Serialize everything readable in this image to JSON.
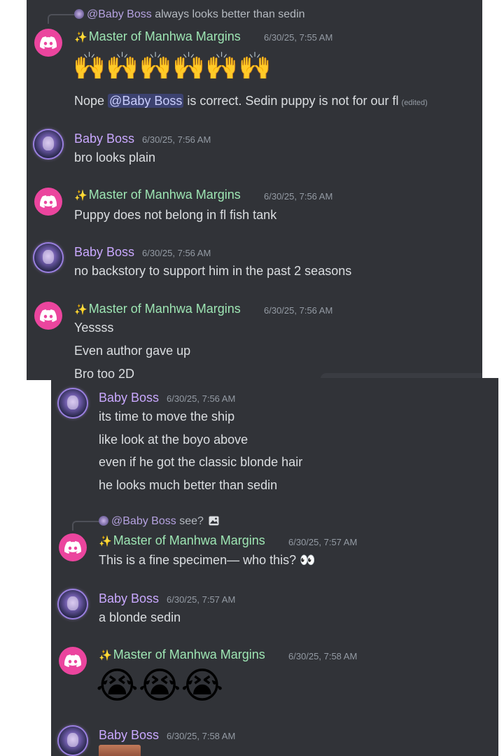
{
  "users": {
    "master": "Master of Manhwa Margins",
    "boss": "Baby Boss"
  },
  "top": {
    "m1": {
      "reply_name": "@Baby Boss",
      "reply_text": "always looks better than sedin",
      "time": "6/30/25, 7:55 AM",
      "emoji": "🙌🙌🙌🙌🙌🙌",
      "text_before": "Nope ",
      "mention": "@Baby Boss",
      "text_after": " is correct. Sedin puppy is not for our fl",
      "edited": "(edited)"
    },
    "m2": {
      "time": "6/30/25, 7:56 AM",
      "lines": [
        "bro looks plain"
      ]
    },
    "m3": {
      "time": "6/30/25, 7:56 AM",
      "lines": [
        "Puppy does not belong in fl fish tank"
      ]
    },
    "m4": {
      "time": "6/30/25, 7:56 AM",
      "lines": [
        "no backstory to support him in the past 2 seasons"
      ]
    },
    "m5": {
      "time": "6/30/25, 7:56 AM",
      "lines": [
        "Yessss",
        "Even author gave up",
        "Bro too 2D"
      ]
    }
  },
  "bottom": {
    "m1": {
      "time": "6/30/25, 7:56 AM",
      "lines": [
        "its time to move the ship",
        "like look at the boyo above",
        "even if he got the classic blonde hair",
        "he looks much better than sedin"
      ]
    },
    "m2": {
      "reply_name": "@Baby Boss",
      "reply_text": "see?",
      "time": "6/30/25, 7:57 AM",
      "text": "This is a fine specimen— who this? 👀"
    },
    "m3": {
      "time": "6/30/25, 7:57 AM",
      "lines": [
        "a blonde sedin"
      ]
    },
    "m4": {
      "time": "6/30/25, 7:58 AM",
      "emoji": "😭😭😭"
    },
    "m5": {
      "time": "6/30/25, 7:58 AM"
    }
  },
  "colors": {
    "background": "#313338",
    "master_name": "#9de5b3",
    "boss_name": "#c9a8ff",
    "text": "#dbdee1",
    "timestamp": "#949ba4",
    "discord_avatar": "#eb459e",
    "mention_bg": "#3c4270"
  },
  "icons": {
    "discord_avatar": "discord-logo-icon",
    "sparkle": "sparkles-icon",
    "image_attachment": "image-icon"
  }
}
